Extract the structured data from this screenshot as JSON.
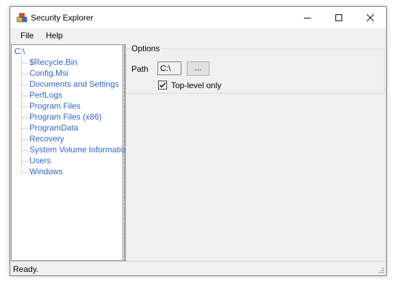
{
  "window": {
    "title": "Security Explorer",
    "controls": {
      "minimize": "minimize-icon",
      "maximize": "maximize-icon",
      "close": "close-icon"
    }
  },
  "menu": {
    "items": [
      {
        "label": "File"
      },
      {
        "label": "Help"
      }
    ]
  },
  "tree": {
    "root": "C:\\",
    "items": [
      {
        "label": "$Recycle.Bin"
      },
      {
        "label": "Config.Msi"
      },
      {
        "label": "Documents and Settings"
      },
      {
        "label": "PerfLogs"
      },
      {
        "label": "Program Files"
      },
      {
        "label": "Program Files (x86)"
      },
      {
        "label": "ProgramData"
      },
      {
        "label": "Recovery"
      },
      {
        "label": "System Volume Information"
      },
      {
        "label": "Users"
      },
      {
        "label": "Windows"
      }
    ]
  },
  "options": {
    "group_title": "Options",
    "path_label": "Path",
    "path_value": "C:\\",
    "browse_label": "...",
    "toplevel_label": "Top-level only",
    "toplevel_checked": true
  },
  "status": {
    "text": "Ready."
  },
  "colors": {
    "tree_link": "#2e63c9",
    "window_bg": "#f0f0f0"
  }
}
